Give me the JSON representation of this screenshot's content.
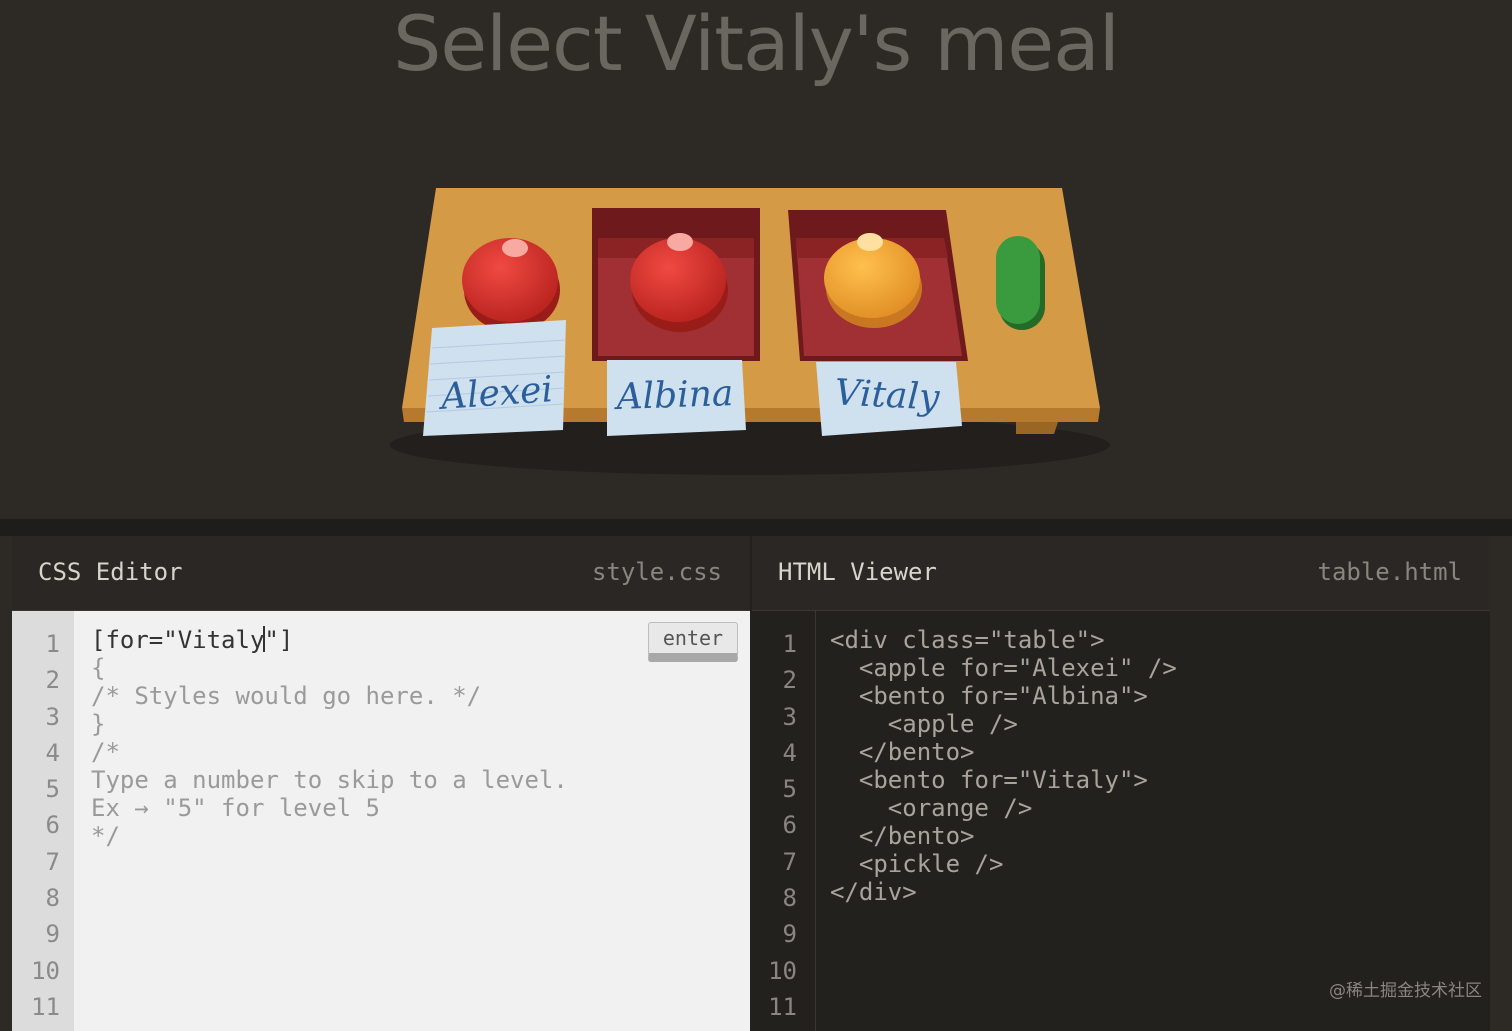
{
  "title": "Select Vitaly's meal",
  "table": {
    "nametags": [
      "Alexei",
      "Albina",
      "Vitaly"
    ],
    "items": [
      {
        "type": "apple",
        "color": "#d5302b"
      },
      {
        "type": "bento-apple",
        "color": "#d5302b"
      },
      {
        "type": "bento-orange",
        "color": "#f0a336"
      },
      {
        "type": "pickle",
        "color": "#3a9a3e"
      }
    ],
    "colors": {
      "table": "#d59a45",
      "bento": "#8b2224",
      "nametag": "#cfe0ee"
    }
  },
  "css_editor": {
    "title": "CSS Editor",
    "filename": "style.css",
    "enter_label": "enter",
    "input_before_caret": "[for=\"Vitaly",
    "input_after_caret": "\"]",
    "lines": [
      "{",
      "/* Styles would go here. */",
      "}",
      "",
      "/*",
      "Type a number to skip to a level.",
      "Ex → \"5\" for level 5",
      "*/",
      "",
      ""
    ],
    "line_numbers": [
      "1",
      "2",
      "3",
      "4",
      "5",
      "6",
      "7",
      "8",
      "9",
      "10",
      "11"
    ]
  },
  "html_viewer": {
    "title": "HTML Viewer",
    "filename": "table.html",
    "lines": [
      "<div class=\"table\">",
      "  <apple for=\"Alexei\" />",
      "  <bento for=\"Albina\">",
      "    <apple />",
      "  </bento>",
      "  <bento for=\"Vitaly\">",
      "    <orange />",
      "  </bento>",
      "  <pickle />",
      "</div>",
      ""
    ],
    "line_numbers": [
      "1",
      "2",
      "3",
      "4",
      "5",
      "6",
      "7",
      "8",
      "9",
      "10",
      "11"
    ]
  },
  "watermark": "@稀土掘金技术社区"
}
